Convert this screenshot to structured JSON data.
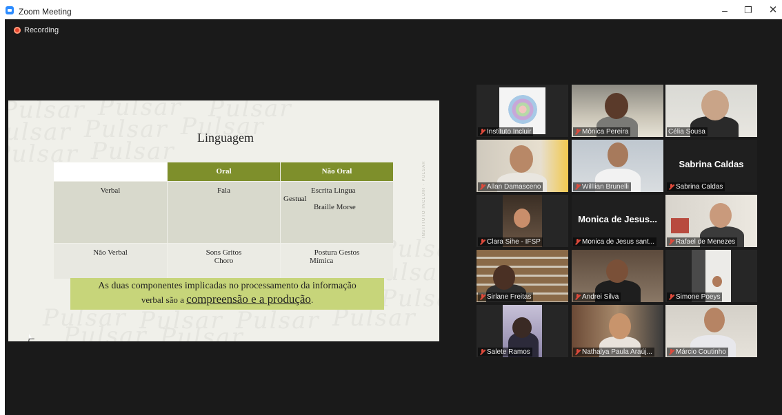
{
  "window": {
    "title": "Zoom Meeting",
    "minimize": "–",
    "maximize": "❐",
    "close": "✕"
  },
  "recording": {
    "label": "Recording"
  },
  "slide": {
    "title": "Linguagem",
    "watermark": "Pulsar",
    "side_mark": "INSTITUTO INCLUIR · PULSAR",
    "headers": [
      "",
      "Oral",
      "Não Oral"
    ],
    "rows": [
      {
        "label": "Verbal",
        "oral": "Fala",
        "nao_oral_1": "Escrita Lingua",
        "nao_oral_2": "Gestual",
        "nao_oral_3": "Braille Morse"
      },
      {
        "label": "Não Verbal",
        "oral_1": "Sons Gritos",
        "oral_2": "Choro",
        "nao_oral_1": "Postura Gestos",
        "nao_oral_2": "Mímica"
      }
    ],
    "callout": {
      "line1": "As duas componentes implicadas no processamento da informação",
      "line2_prefix": "verbal são a ",
      "line2_emph": "compreensão e a produção",
      "line2_suffix": "."
    }
  },
  "participants": [
    {
      "name": "Instituto Incluir",
      "muted": true,
      "video": true
    },
    {
      "name": "Mônica Pereira",
      "muted": true,
      "video": true
    },
    {
      "name": "Célia Sousa",
      "muted": false,
      "video": true,
      "active_speaker": true
    },
    {
      "name": "Allan Damasceno",
      "muted": true,
      "video": true
    },
    {
      "name": "Willlian Brunelli",
      "muted": true,
      "video": true
    },
    {
      "name": "Sabrina Caldas",
      "display": "Sabrina Caldas",
      "muted": true,
      "video": false
    },
    {
      "name": "Clara Sihe - IFSP",
      "muted": true,
      "video": true
    },
    {
      "name": "Monica de Jesus sant...",
      "display": "Monica de Jesus...",
      "muted": true,
      "video": false
    },
    {
      "name": "Rafael de Menezes",
      "muted": true,
      "video": true
    },
    {
      "name": "Sirlane Freitas",
      "muted": true,
      "video": true
    },
    {
      "name": "Andrei Silva",
      "muted": true,
      "video": true
    },
    {
      "name": "Simone Poeys",
      "muted": true,
      "video": true
    },
    {
      "name": "Salete Ramos",
      "muted": true,
      "video": true
    },
    {
      "name": "Nathalya Paula Araúj...",
      "muted": true,
      "video": true
    },
    {
      "name": "Márcio Coutinho",
      "muted": true,
      "video": true
    }
  ],
  "colors": {
    "accent_green": "#7e8f2b",
    "callout_bg": "#c7d57a",
    "active_border": "#c8e66b",
    "muted_red": "#e04a3b"
  }
}
